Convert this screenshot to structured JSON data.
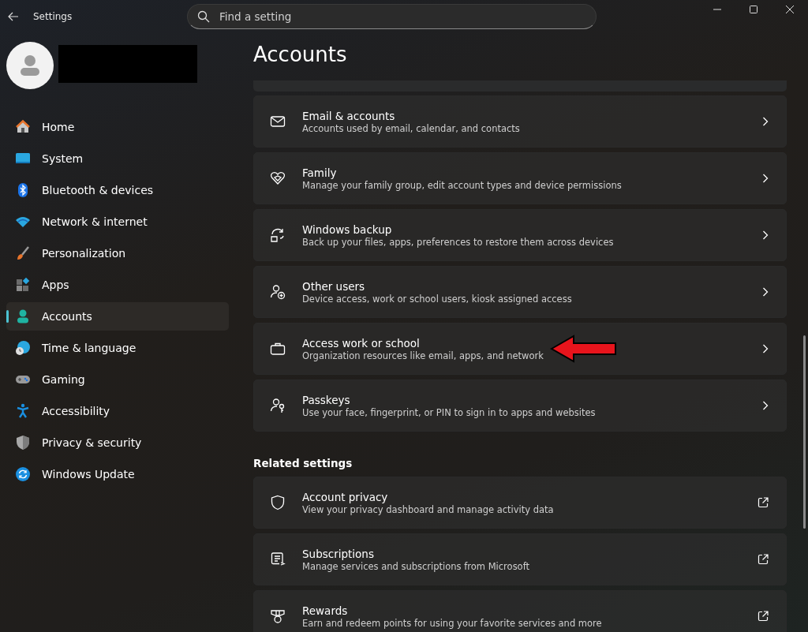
{
  "window": {
    "title": "Settings"
  },
  "search": {
    "placeholder": "Find a setting"
  },
  "sidebar": {
    "items": [
      {
        "label": "Home",
        "selected": false
      },
      {
        "label": "System",
        "selected": false
      },
      {
        "label": "Bluetooth & devices",
        "selected": false
      },
      {
        "label": "Network & internet",
        "selected": false
      },
      {
        "label": "Personalization",
        "selected": false
      },
      {
        "label": "Apps",
        "selected": false
      },
      {
        "label": "Accounts",
        "selected": true
      },
      {
        "label": "Time & language",
        "selected": false
      },
      {
        "label": "Gaming",
        "selected": false
      },
      {
        "label": "Accessibility",
        "selected": false
      },
      {
        "label": "Privacy & security",
        "selected": false
      },
      {
        "label": "Windows Update",
        "selected": false
      }
    ]
  },
  "page": {
    "title": "Accounts"
  },
  "cards": [
    {
      "title": "Email & accounts",
      "description": "Accounts used by email, calendar, and contacts",
      "kind": "chevron"
    },
    {
      "title": "Family",
      "description": "Manage your family group, edit account types and device permissions",
      "kind": "chevron"
    },
    {
      "title": "Windows backup",
      "description": "Back up your files, apps, preferences to restore them across devices",
      "kind": "chevron"
    },
    {
      "title": "Other users",
      "description": "Device access, work or school users, kiosk assigned access",
      "kind": "chevron"
    },
    {
      "title": "Access work or school",
      "description": "Organization resources like email, apps, and network",
      "kind": "chevron"
    },
    {
      "title": "Passkeys",
      "description": "Use your face, fingerprint, or PIN to sign in to apps and websites",
      "kind": "chevron"
    }
  ],
  "related_settings": {
    "heading": "Related settings",
    "cards": [
      {
        "title": "Account privacy",
        "description": "View your privacy dashboard and manage activity data",
        "kind": "external"
      },
      {
        "title": "Subscriptions",
        "description": "Manage services and subscriptions from Microsoft",
        "kind": "external"
      },
      {
        "title": "Rewards",
        "description": "Earn and redeem points for using your favorite services and more",
        "kind": "external"
      }
    ]
  }
}
